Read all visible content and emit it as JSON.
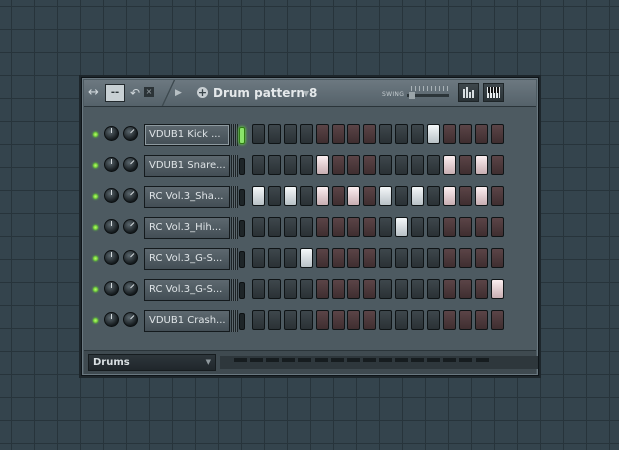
{
  "window": {
    "pattern_name": "Drum pattern 8",
    "swing_label": "SWING",
    "dash_button": "--",
    "close_glyph": "×"
  },
  "channels": [
    {
      "name": "VDUB1 Kick ...",
      "selected": true,
      "steps": [
        0,
        0,
        0,
        0,
        0,
        0,
        0,
        0,
        0,
        0,
        0,
        1,
        0,
        0,
        0,
        0
      ]
    },
    {
      "name": "VDUB1 Snare...",
      "selected": false,
      "steps": [
        0,
        0,
        0,
        0,
        1,
        0,
        0,
        0,
        0,
        0,
        0,
        0,
        1,
        0,
        1,
        0
      ]
    },
    {
      "name": "RC Vol.3_Sha...",
      "selected": false,
      "steps": [
        1,
        0,
        1,
        0,
        1,
        0,
        1,
        0,
        1,
        0,
        1,
        0,
        1,
        0,
        1,
        0
      ]
    },
    {
      "name": "RC Vol.3_Hih...",
      "selected": false,
      "steps": [
        0,
        0,
        0,
        0,
        0,
        0,
        0,
        0,
        0,
        1,
        0,
        0,
        0,
        0,
        0,
        0
      ]
    },
    {
      "name": "RC Vol.3_G-S...",
      "selected": false,
      "steps": [
        0,
        0,
        0,
        1,
        0,
        0,
        0,
        0,
        0,
        0,
        0,
        0,
        0,
        0,
        0,
        0
      ]
    },
    {
      "name": "RC Vol.3_G-S...",
      "selected": false,
      "steps": [
        0,
        0,
        0,
        0,
        0,
        0,
        0,
        0,
        0,
        0,
        0,
        0,
        0,
        0,
        0,
        1
      ]
    },
    {
      "name": "VDUB1 Crash...",
      "selected": false,
      "steps": [
        0,
        0,
        0,
        0,
        0,
        0,
        0,
        0,
        0,
        0,
        0,
        0,
        0,
        0,
        0,
        0
      ]
    }
  ],
  "footer": {
    "group": "Drums"
  },
  "colors": {
    "step_off_dark": "#333b40",
    "step_off_red": "#4d393c",
    "step_on": "#e9eef1",
    "led_green": "#6cff2a"
  }
}
